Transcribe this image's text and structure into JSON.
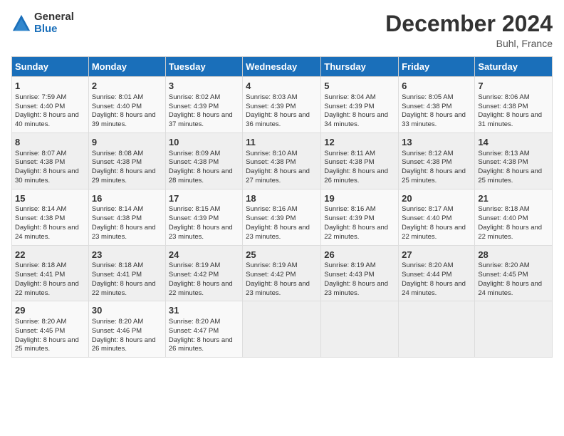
{
  "header": {
    "logo_general": "General",
    "logo_blue": "Blue",
    "title": "December 2024",
    "location": "Buhl, France"
  },
  "weekdays": [
    "Sunday",
    "Monday",
    "Tuesday",
    "Wednesday",
    "Thursday",
    "Friday",
    "Saturday"
  ],
  "weeks": [
    [
      {
        "day": "1",
        "sunrise": "Sunrise: 7:59 AM",
        "sunset": "Sunset: 4:40 PM",
        "daylight": "Daylight: 8 hours and 40 minutes."
      },
      {
        "day": "2",
        "sunrise": "Sunrise: 8:01 AM",
        "sunset": "Sunset: 4:40 PM",
        "daylight": "Daylight: 8 hours and 39 minutes."
      },
      {
        "day": "3",
        "sunrise": "Sunrise: 8:02 AM",
        "sunset": "Sunset: 4:39 PM",
        "daylight": "Daylight: 8 hours and 37 minutes."
      },
      {
        "day": "4",
        "sunrise": "Sunrise: 8:03 AM",
        "sunset": "Sunset: 4:39 PM",
        "daylight": "Daylight: 8 hours and 36 minutes."
      },
      {
        "day": "5",
        "sunrise": "Sunrise: 8:04 AM",
        "sunset": "Sunset: 4:39 PM",
        "daylight": "Daylight: 8 hours and 34 minutes."
      },
      {
        "day": "6",
        "sunrise": "Sunrise: 8:05 AM",
        "sunset": "Sunset: 4:38 PM",
        "daylight": "Daylight: 8 hours and 33 minutes."
      },
      {
        "day": "7",
        "sunrise": "Sunrise: 8:06 AM",
        "sunset": "Sunset: 4:38 PM",
        "daylight": "Daylight: 8 hours and 31 minutes."
      }
    ],
    [
      {
        "day": "8",
        "sunrise": "Sunrise: 8:07 AM",
        "sunset": "Sunset: 4:38 PM",
        "daylight": "Daylight: 8 hours and 30 minutes."
      },
      {
        "day": "9",
        "sunrise": "Sunrise: 8:08 AM",
        "sunset": "Sunset: 4:38 PM",
        "daylight": "Daylight: 8 hours and 29 minutes."
      },
      {
        "day": "10",
        "sunrise": "Sunrise: 8:09 AM",
        "sunset": "Sunset: 4:38 PM",
        "daylight": "Daylight: 8 hours and 28 minutes."
      },
      {
        "day": "11",
        "sunrise": "Sunrise: 8:10 AM",
        "sunset": "Sunset: 4:38 PM",
        "daylight": "Daylight: 8 hours and 27 minutes."
      },
      {
        "day": "12",
        "sunrise": "Sunrise: 8:11 AM",
        "sunset": "Sunset: 4:38 PM",
        "daylight": "Daylight: 8 hours and 26 minutes."
      },
      {
        "day": "13",
        "sunrise": "Sunrise: 8:12 AM",
        "sunset": "Sunset: 4:38 PM",
        "daylight": "Daylight: 8 hours and 25 minutes."
      },
      {
        "day": "14",
        "sunrise": "Sunrise: 8:13 AM",
        "sunset": "Sunset: 4:38 PM",
        "daylight": "Daylight: 8 hours and 25 minutes."
      }
    ],
    [
      {
        "day": "15",
        "sunrise": "Sunrise: 8:14 AM",
        "sunset": "Sunset: 4:38 PM",
        "daylight": "Daylight: 8 hours and 24 minutes."
      },
      {
        "day": "16",
        "sunrise": "Sunrise: 8:14 AM",
        "sunset": "Sunset: 4:38 PM",
        "daylight": "Daylight: 8 hours and 23 minutes."
      },
      {
        "day": "17",
        "sunrise": "Sunrise: 8:15 AM",
        "sunset": "Sunset: 4:39 PM",
        "daylight": "Daylight: 8 hours and 23 minutes."
      },
      {
        "day": "18",
        "sunrise": "Sunrise: 8:16 AM",
        "sunset": "Sunset: 4:39 PM",
        "daylight": "Daylight: 8 hours and 23 minutes."
      },
      {
        "day": "19",
        "sunrise": "Sunrise: 8:16 AM",
        "sunset": "Sunset: 4:39 PM",
        "daylight": "Daylight: 8 hours and 22 minutes."
      },
      {
        "day": "20",
        "sunrise": "Sunrise: 8:17 AM",
        "sunset": "Sunset: 4:40 PM",
        "daylight": "Daylight: 8 hours and 22 minutes."
      },
      {
        "day": "21",
        "sunrise": "Sunrise: 8:18 AM",
        "sunset": "Sunset: 4:40 PM",
        "daylight": "Daylight: 8 hours and 22 minutes."
      }
    ],
    [
      {
        "day": "22",
        "sunrise": "Sunrise: 8:18 AM",
        "sunset": "Sunset: 4:41 PM",
        "daylight": "Daylight: 8 hours and 22 minutes."
      },
      {
        "day": "23",
        "sunrise": "Sunrise: 8:18 AM",
        "sunset": "Sunset: 4:41 PM",
        "daylight": "Daylight: 8 hours and 22 minutes."
      },
      {
        "day": "24",
        "sunrise": "Sunrise: 8:19 AM",
        "sunset": "Sunset: 4:42 PM",
        "daylight": "Daylight: 8 hours and 22 minutes."
      },
      {
        "day": "25",
        "sunrise": "Sunrise: 8:19 AM",
        "sunset": "Sunset: 4:42 PM",
        "daylight": "Daylight: 8 hours and 23 minutes."
      },
      {
        "day": "26",
        "sunrise": "Sunrise: 8:19 AM",
        "sunset": "Sunset: 4:43 PM",
        "daylight": "Daylight: 8 hours and 23 minutes."
      },
      {
        "day": "27",
        "sunrise": "Sunrise: 8:20 AM",
        "sunset": "Sunset: 4:44 PM",
        "daylight": "Daylight: 8 hours and 24 minutes."
      },
      {
        "day": "28",
        "sunrise": "Sunrise: 8:20 AM",
        "sunset": "Sunset: 4:45 PM",
        "daylight": "Daylight: 8 hours and 24 minutes."
      }
    ],
    [
      {
        "day": "29",
        "sunrise": "Sunrise: 8:20 AM",
        "sunset": "Sunset: 4:45 PM",
        "daylight": "Daylight: 8 hours and 25 minutes."
      },
      {
        "day": "30",
        "sunrise": "Sunrise: 8:20 AM",
        "sunset": "Sunset: 4:46 PM",
        "daylight": "Daylight: 8 hours and 26 minutes."
      },
      {
        "day": "31",
        "sunrise": "Sunrise: 8:20 AM",
        "sunset": "Sunset: 4:47 PM",
        "daylight": "Daylight: 8 hours and 26 minutes."
      },
      null,
      null,
      null,
      null
    ]
  ]
}
